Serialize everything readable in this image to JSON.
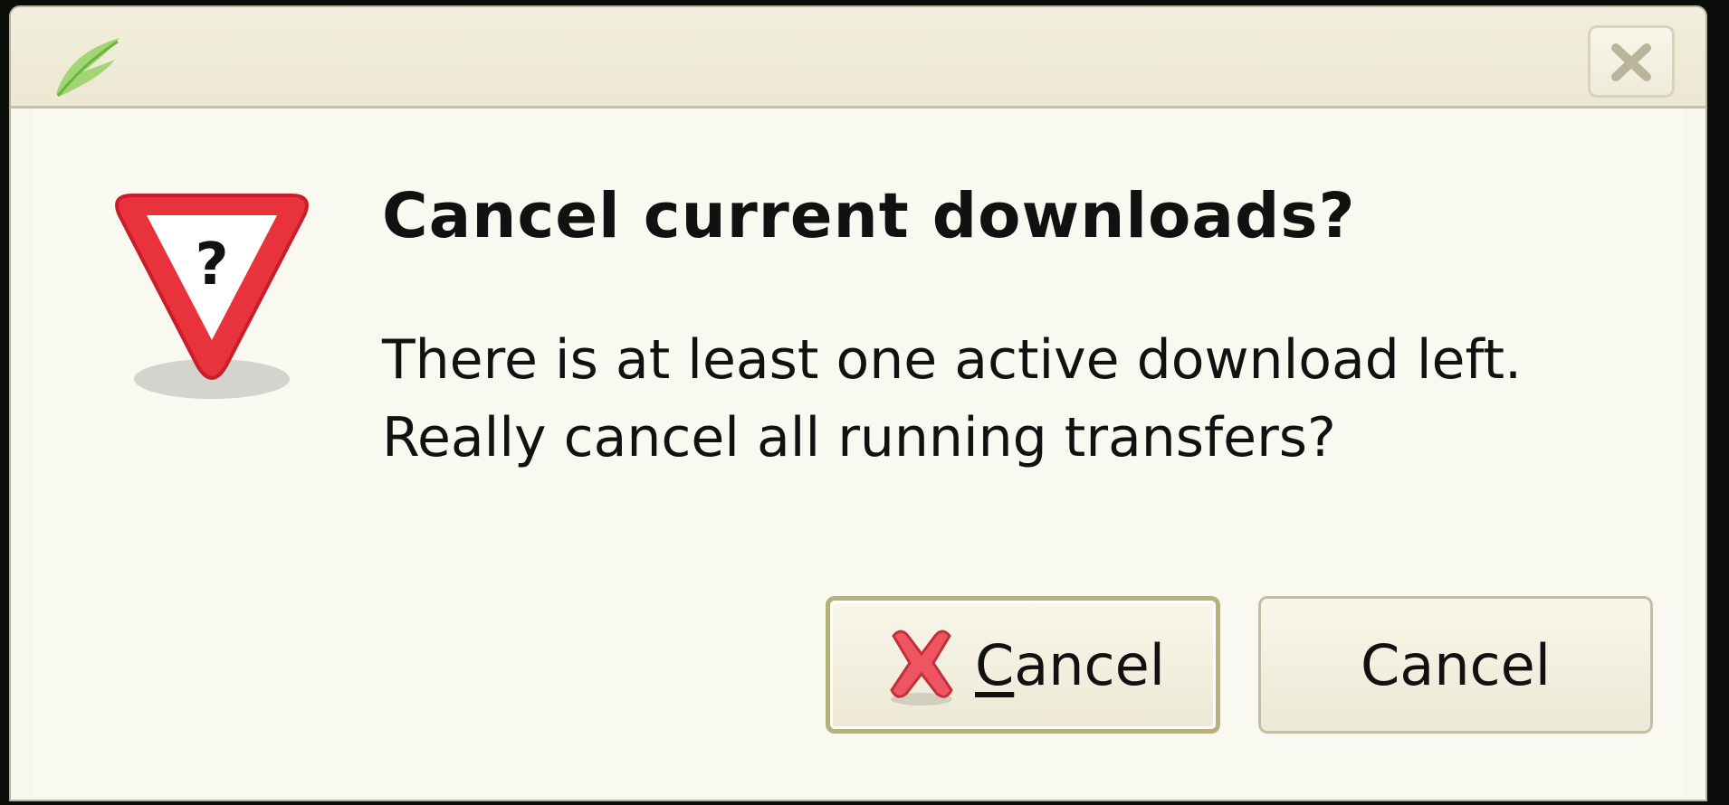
{
  "window": {
    "close_icon": "close-icon",
    "app_icon": "leaf-app-icon"
  },
  "dialog": {
    "icon": "question-warning-icon",
    "heading": "Cancel current downloads?",
    "message_line1": "There is at least one active download left.",
    "message_line2": "Really cancel all running transfers?"
  },
  "buttons": {
    "primary": {
      "icon": "cancel-x-icon",
      "mnemonic": "C",
      "label_rest": "ancel"
    },
    "secondary": {
      "label": "Cancel"
    }
  },
  "colors": {
    "background": "#f9f8f1",
    "titlebar": "#ece8d2",
    "warning_red": "#e8323c",
    "button_border_focus": "#b6b07a"
  }
}
